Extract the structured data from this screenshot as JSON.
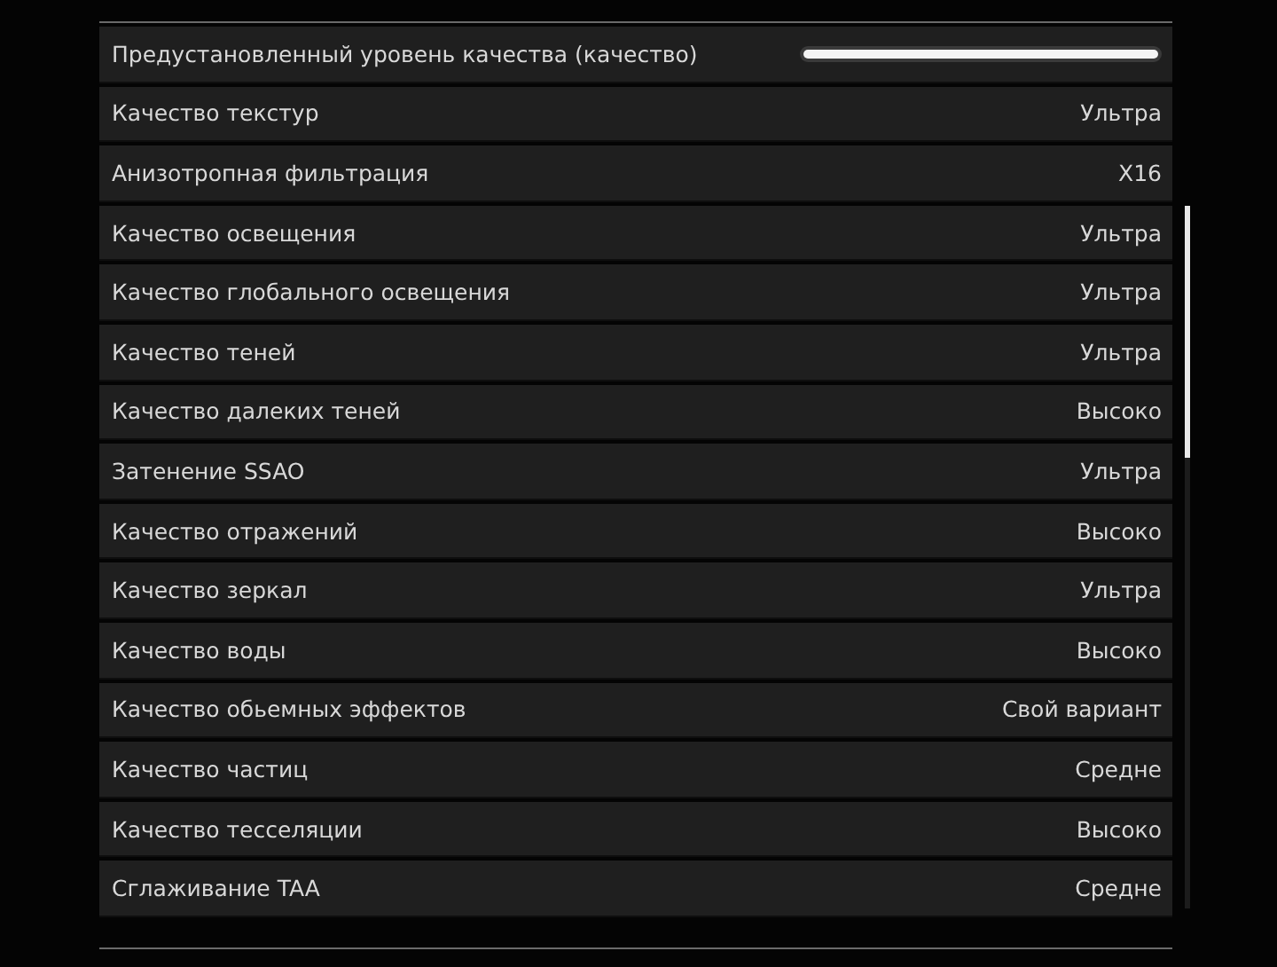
{
  "settings": [
    {
      "label": "Предустановленный уровень качества (качество)",
      "kind": "slider",
      "level": 1
    },
    {
      "label": "Качество текстур",
      "kind": "value",
      "value": "Ультра"
    },
    {
      "label": "Анизотропная фильтрация",
      "kind": "value",
      "value": "X16"
    },
    {
      "label": "Качество освещения",
      "kind": "value",
      "value": "Ультра"
    },
    {
      "label": "Качество глобального освещения",
      "kind": "value",
      "value": "Ультра"
    },
    {
      "label": "Качество теней",
      "kind": "value",
      "value": "Ультра"
    },
    {
      "label": "Качество далеких теней",
      "kind": "value",
      "value": "Высоко"
    },
    {
      "label": "Затенение SSAO",
      "kind": "value",
      "value": "Ультра"
    },
    {
      "label": "Качество отражений",
      "kind": "value",
      "value": "Высоко"
    },
    {
      "label": "Качество зеркал",
      "kind": "value",
      "value": "Ультра"
    },
    {
      "label": "Качество воды",
      "kind": "value",
      "value": "Высоко"
    },
    {
      "label": "Качество обьемных эффектов",
      "kind": "value",
      "value": "Свой вариант"
    },
    {
      "label": "Качество частиц",
      "kind": "value",
      "value": "Средне"
    },
    {
      "label": "Качество тесселяции",
      "kind": "value",
      "value": "Высоко"
    },
    {
      "label": "Сглаживание TAA",
      "kind": "value",
      "value": "Средне"
    }
  ]
}
